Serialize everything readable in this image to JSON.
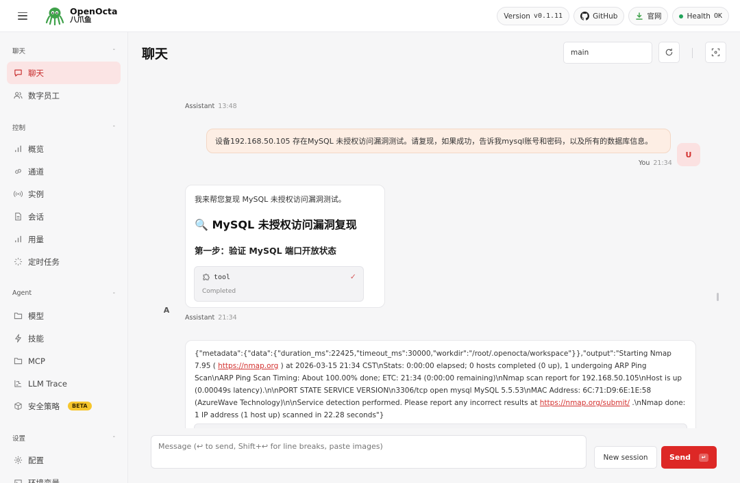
{
  "brand": {
    "name": "OpenOcta",
    "sub": "八爪鱼"
  },
  "topbar": {
    "version_label": "Version",
    "version_value": "v0.1.11",
    "github": "GitHub",
    "website": "官网",
    "health_label": "Health",
    "health_value": "OK"
  },
  "sidebar": {
    "sections": [
      {
        "title": "聊天",
        "items": [
          {
            "label": "聊天",
            "icon": "chat-icon",
            "active": true
          },
          {
            "label": "数字员工",
            "icon": "users-icon"
          }
        ]
      },
      {
        "title": "控制",
        "items": [
          {
            "label": "概览",
            "icon": "bar-chart-icon"
          },
          {
            "label": "通道",
            "icon": "link-icon"
          },
          {
            "label": "实例",
            "icon": "broadcast-icon"
          },
          {
            "label": "会话",
            "icon": "document-icon"
          },
          {
            "label": "用量",
            "icon": "bar-chart-icon"
          },
          {
            "label": "定时任务",
            "icon": "loader-icon"
          }
        ]
      },
      {
        "title": "Agent",
        "items": [
          {
            "label": "模型",
            "icon": "folder-icon"
          },
          {
            "label": "技能",
            "icon": "bolt-icon"
          },
          {
            "label": "MCP",
            "icon": "folder-icon"
          },
          {
            "label": "LLM Trace",
            "icon": "trace-icon"
          },
          {
            "label": "安全策略",
            "icon": "cube-icon",
            "badge": "BETA"
          }
        ]
      },
      {
        "title": "设置",
        "items": [
          {
            "label": "配置",
            "icon": "gear-icon"
          },
          {
            "label": "环境变量",
            "icon": "env-icon"
          }
        ]
      }
    ]
  },
  "main": {
    "title": "聊天",
    "session_value": "main"
  },
  "chat": {
    "msg1_sender": "Assistant",
    "msg1_time": "13:48",
    "user_text": "设备192.168.50.105 存在MySQL 未授权访问漏洞测试。请复现，如果成功，告诉我mysql账号和密码，以及所有的数据库信息。",
    "user_sender": "You",
    "user_time": "21:34",
    "user_avatar": "U",
    "assistant_avatar": "A",
    "reply_intro": "我来帮您复现 MySQL 未授权访问漏洞测试。",
    "reply_h1_icon": "🔍",
    "reply_h1": "MySQL 未授权访问漏洞复现",
    "reply_h2": "第一步：验证 MySQL 端口开放状态",
    "tool_name": "tool",
    "tool_status": "Completed",
    "reply_sender": "Assistant",
    "reply_time": "21:34",
    "output_part1": "{\"metadata\":{\"data\":{\"duration_ms\":22425,\"timeout_ms\":30000,\"workdir\":\"/root/.openocta/workspace\"}},\"output\":\"Starting Nmap 7.95 ( ",
    "output_link1": "https://nmap.org",
    "output_part2": " ) at 2026-03-15 21:34 CST\\nStats: 0:00:00 elapsed; 0 hosts completed (0 up), 1 undergoing ARP Ping Scan\\nARP Ping Scan Timing: About 100.00% done; ETC: 21:34 (0:00:00 remaining)\\nNmap scan report for 192.168.50.105\\nHost is up (0.00049s latency).\\n\\nPORT STATE SERVICE VERSION\\n3306/tcp open mysql MySQL 5.5.53\\nMAC Address: 6C:71:D9:6E:1E:58 (AzureWave Technology)\\n\\nService detection performed. Please report any incorrect results at ",
    "output_link2": "https://nmap.org/submit/",
    "output_part3": " .\\nNmap done: 1 IP address (1 host up) scanned in 22.28 seconds\"}"
  },
  "composer": {
    "placeholder": "Message (↩ to send, Shift+↩ for line breaks, paste images)",
    "new_session": "New session",
    "send": "Send",
    "send_key": "↵"
  },
  "colors": {
    "accent": "#dd2826",
    "active_bg": "#fbe4e4",
    "user_bubble": "#fdeee4",
    "health": "#21a35a"
  }
}
